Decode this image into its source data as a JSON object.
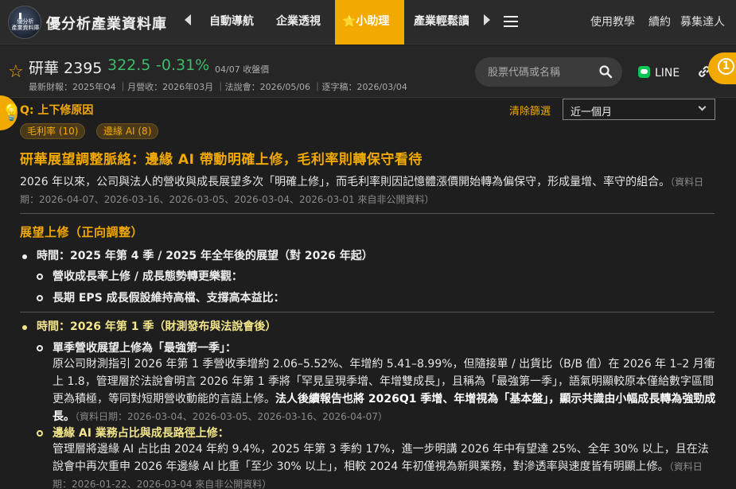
{
  "nav": {
    "logo_text": "優分析\n產業資料庫",
    "brand": "優分析產業資料庫",
    "tabs": [
      "自動導航",
      "企業透視",
      "⭐小助理",
      "產業輕鬆讀"
    ],
    "right_links": [
      "使用教學",
      "續約",
      "募集達人"
    ]
  },
  "stock": {
    "name": "研華 2395",
    "price": "322.5",
    "change": "-0.31%",
    "close_date": "04/07 收盤價",
    "meta": "最新財報：2025年Q4 ｜月營收：2026年03月 ｜法說會：2026/05/06 ｜逐字稿：2026/03/04"
  },
  "search": {
    "placeholder": "股票代碼或名稱"
  },
  "share": {
    "line_label": "LINE"
  },
  "notification_count": "1",
  "filters": {
    "question_label": "Q: 上下修原因",
    "clear_label": "清除篩選",
    "period_selected": "近一個月",
    "chips": [
      "毛利率 (10)",
      "邊緣 AI (8)"
    ]
  },
  "article": {
    "title": "研華展望調整脈絡：邊緣 AI 帶動明確上修，毛利率則轉保守看待",
    "intro": "2026 年以來，公司與法人的營收與成長展望多次「明確上修」，而毛利率則因記憶體漲價開始轉為偏保守，形成量增、率守的組合。",
    "intro_source": "（資料日期：2026-04-07、2026-03-16、2026-03-05、2026-03-04、2026-03-01 來自非公開資料）",
    "section_title": "展望上修（正向調整）",
    "b1": "時間：2025 年第 4 季 / 2025 年全年後的展望（對 2026 年起）",
    "b1a": "營收成長率上修 / 成長態勢轉更樂觀：",
    "b1b": "長期 EPS 成長假設維持高檔、支撐高本益比：",
    "b2": "時間：2026 年第 1 季（財測發布與法說會後）",
    "b2a": "單季營收展望上修為「最強第一季」：",
    "b2a_text": "原公司財測指引 2026 年第 1 季營收季增約 2.06–5.52%、年增約 5.41–8.99%，但隨接單 / 出貨比（B/B 值）在 2026 年 1–2 月衝上 1.8，管理層於法說會明言 2026 年第 1 季將「罕見呈現季增、年增雙成長」，且稱為「最強第一季」，語氣明顯較原本僅給數字區間更為積極，等同對短期營收動能的言語上修。",
    "b2a_bold": "法人後續報告也將 2026Q1 季增、年增視為「基本盤」，顯示共識由小幅成長轉為強勁成長。",
    "b2a_source": "（資料日期：2026-03-04、2026-03-05、2026-03-16、2026-04-07）",
    "b2b": "邊緣 AI 業務占比與成長路徑上修：",
    "b2b_text": "管理層將邊緣 AI 占比由 2024 年約 9.4%，2025 年第 3 季約 17%，進一步明講 2026 年中有望達 25%、全年 30% 以上，且在法說會中再次重申 2026 年邊緣 AI 比重「至少 30% 以上」，相較 2024 年初僅視為新興業務，對滲透率與速度皆有明顯上修。",
    "b2b_source": "（資料日期：2026-01-22、2026-03-04 來自非公開資料）"
  }
}
